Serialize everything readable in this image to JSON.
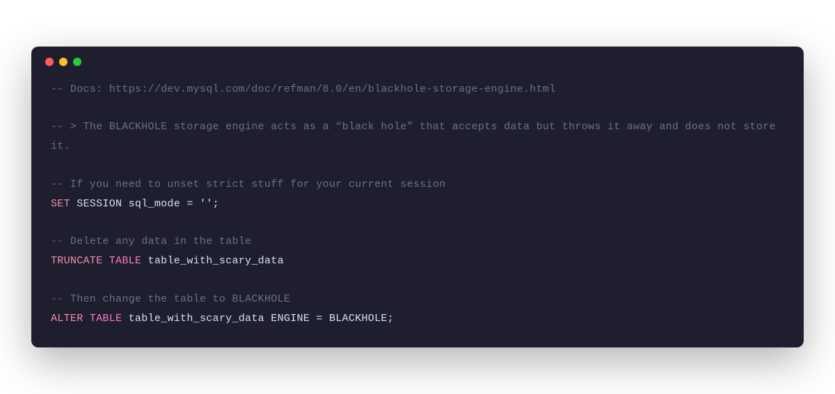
{
  "code": {
    "line1_comment": "-- Docs: https://dev.mysql.com/doc/refman/8.0/en/blackhole-storage-engine.html",
    "line2_comment": "-- > The BLACKHOLE storage engine acts as a “black hole” that accepts data but throws it away and does not store it.",
    "line3_comment": "-- If you need to unset strict stuff for your current session",
    "line4_kw1": "SET",
    "line4_text1": " SESSION sql_mode ",
    "line4_op": "=",
    "line4_text2": " ",
    "line4_str": "''",
    "line4_semi": ";",
    "line5_comment": "-- Delete any data in the table",
    "line6_kw1": "TRUNCATE",
    "line6_kw2": " TABLE",
    "line6_text": " table_with_scary_data",
    "line7_comment": "-- Then change the table to BLACKHOLE",
    "line8_kw1": "ALTER",
    "line8_kw2": " TABLE",
    "line8_text1": " table_with_scary_data ENGINE ",
    "line8_op": "=",
    "line8_text2": " BLACKHOLE;",
    "traffic_lights": {
      "red": "#ff5f56",
      "yellow": "#ffbd2e",
      "green": "#27c93f"
    }
  }
}
